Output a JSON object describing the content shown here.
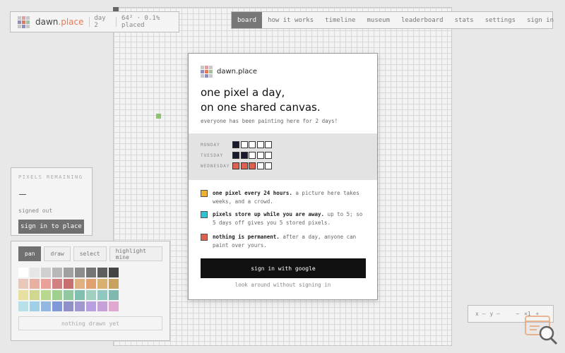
{
  "brand": {
    "name_main": "dawn",
    "name_accent": ".place",
    "day": "day 2",
    "placed_stats": "64² · 0.1% placed",
    "logo_colors": [
      "#c8c8c8",
      "#e0a0a0",
      "#c8c8c8",
      "#9090c0",
      "#e07b5a",
      "#a0c0a0",
      "#c8c8c8",
      "#9090c0",
      "#c8c8c8"
    ]
  },
  "nav": {
    "items": [
      "board",
      "how it works",
      "timeline",
      "museum",
      "leaderboard",
      "stats",
      "settings",
      "sign in"
    ],
    "active": "board"
  },
  "pixels_panel": {
    "label": "PIXELS REMAINING",
    "status": "signed out",
    "signin_label": "sign in to place"
  },
  "toolbox": {
    "tabs": [
      "pan",
      "draw",
      "select",
      "highlight mine"
    ],
    "active_tab": "pan",
    "palette": [
      "#ffffff",
      "#e6e6e6",
      "#d0d0d0",
      "#b8b8b8",
      "#a0a0a0",
      "#8c8c8c",
      "#757575",
      "#5e5e5e",
      "#444444",
      "#e8c8b8",
      "#e8b0a0",
      "#e8a098",
      "#d08080",
      "#c87070",
      "#e0b080",
      "#e0a070",
      "#d8b070",
      "#c8a060",
      "#e8e0a0",
      "#d0d890",
      "#b8d890",
      "#a0d090",
      "#90c8a0",
      "#80c0b0",
      "#a0d0c0",
      "#90c8c0",
      "#80b8b0",
      "#b8e0e8",
      "#a0d0e8",
      "#90b8e0",
      "#8098d8",
      "#9090c8",
      "#a098d0",
      "#b8a0e0",
      "#c8a0d8",
      "#e0a8d0"
    ],
    "drawn_status": "nothing drawn yet"
  },
  "coords": {
    "x": "x —",
    "y": "y —",
    "minus": "−",
    "zoom": "×1",
    "plus": "+"
  },
  "modal": {
    "brand_name": "dawn.place",
    "headline_1": "one pixel a day,",
    "headline_2": "on one shared canvas.",
    "subtitle": "everyone has been painting here for 2 days!",
    "days": [
      {
        "name": "MONDAY",
        "cells": [
          "#1a1a2e",
          "#ffffff",
          "#ffffff",
          "#ffffff",
          "#ffffff"
        ]
      },
      {
        "name": "TUESDAY",
        "cells": [
          "#1a1a2e",
          "#1a1a2e",
          "#ffffff",
          "#ffffff",
          "#ffffff"
        ]
      },
      {
        "name": "WEDNESDAY",
        "cells": [
          "#e06050",
          "#e06050",
          "#e06050",
          "#ffffff",
          "#ffffff"
        ]
      }
    ],
    "features": [
      {
        "color": "#f0b030",
        "bold": "one pixel every 24 hours.",
        "text": " a picture here takes weeks, and a crowd."
      },
      {
        "color": "#30c0d8",
        "bold": "pixels store up while you are away.",
        "text": " up to 5; so 5 days off gives you 5 stored pixels."
      },
      {
        "color": "#e06050",
        "bold": "nothing is permanent.",
        "text": " after a day, anyone can paint over yours."
      }
    ],
    "google_label": "sign in with google",
    "look_label": "look around without signing in"
  }
}
